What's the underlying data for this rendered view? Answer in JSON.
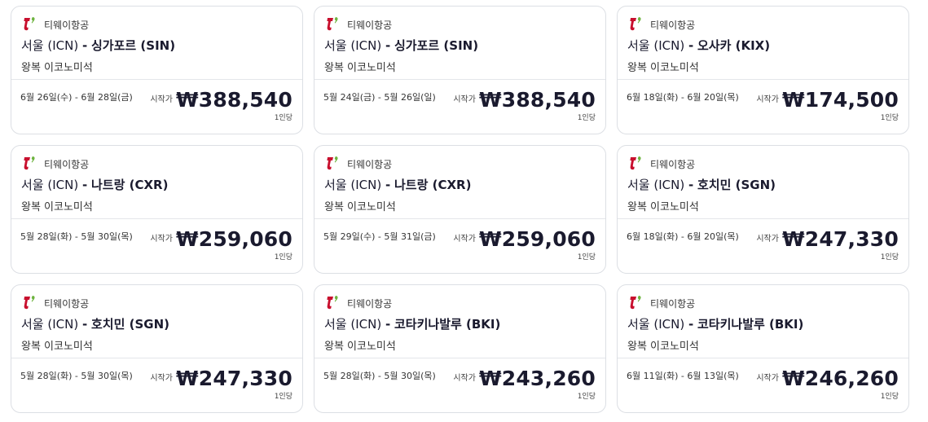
{
  "brand": {
    "logo_red": "#c8102e",
    "logo_green": "#6db33f"
  },
  "labels": {
    "from": "시작가",
    "per_person": "1인당"
  },
  "cards": [
    {
      "airline": "티웨이항공",
      "origin": "서울 (ICN)",
      "sep": "-",
      "dest": "싱가포르 (SIN)",
      "cabin": "왕복 이코노미석",
      "dates": "6월 26일(수) - 6월 28일(금)",
      "price": "₩388,540"
    },
    {
      "airline": "티웨이항공",
      "origin": "서울 (ICN)",
      "sep": "-",
      "dest": "싱가포르 (SIN)",
      "cabin": "왕복 이코노미석",
      "dates": "5월 24일(금) - 5월 26일(일)",
      "price": "₩388,540"
    },
    {
      "airline": "티웨이항공",
      "origin": "서울 (ICN)",
      "sep": "-",
      "dest": "오사카 (KIX)",
      "cabin": "왕복 이코노미석",
      "dates": "6월 18일(화) - 6월 20일(목)",
      "price": "₩174,500"
    },
    {
      "airline": "티웨이항공",
      "origin": "서울 (ICN)",
      "sep": "-",
      "dest": "나트랑 (CXR)",
      "cabin": "왕복 이코노미석",
      "dates": "5월 28일(화) - 5월 30일(목)",
      "price": "₩259,060"
    },
    {
      "airline": "티웨이항공",
      "origin": "서울 (ICN)",
      "sep": "-",
      "dest": "나트랑 (CXR)",
      "cabin": "왕복 이코노미석",
      "dates": "5월 29일(수) - 5월 31일(금)",
      "price": "₩259,060"
    },
    {
      "airline": "티웨이항공",
      "origin": "서울 (ICN)",
      "sep": "-",
      "dest": "호치민 (SGN)",
      "cabin": "왕복 이코노미석",
      "dates": "6월 18일(화) - 6월 20일(목)",
      "price": "₩247,330"
    },
    {
      "airline": "티웨이항공",
      "origin": "서울 (ICN)",
      "sep": "-",
      "dest": "호치민 (SGN)",
      "cabin": "왕복 이코노미석",
      "dates": "5월 28일(화) - 5월 30일(목)",
      "price": "₩247,330"
    },
    {
      "airline": "티웨이항공",
      "origin": "서울 (ICN)",
      "sep": "-",
      "dest": "코타키나발루 (BKI)",
      "cabin": "왕복 이코노미석",
      "dates": "5월 28일(화) - 5월 30일(목)",
      "price": "₩243,260"
    },
    {
      "airline": "티웨이항공",
      "origin": "서울 (ICN)",
      "sep": "-",
      "dest": "코타키나발루 (BKI)",
      "cabin": "왕복 이코노미석",
      "dates": "6월 11일(화) - 6월 13일(목)",
      "price": "₩246,260"
    }
  ]
}
